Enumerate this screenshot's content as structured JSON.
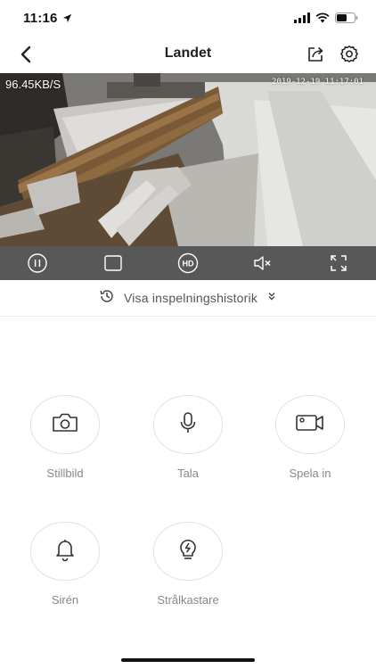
{
  "status_bar": {
    "time": "11:16"
  },
  "nav": {
    "title": "Landet"
  },
  "video": {
    "speed": "96.45KB/S",
    "timestamp": "2019-12-19 11:17:01"
  },
  "history": {
    "label": "Visa inspelningshistorik"
  },
  "actions": {
    "snapshot": "Stillbild",
    "talk": "Tala",
    "record": "Spela in",
    "siren": "Sirén",
    "spotlight": "Strålkastare"
  },
  "controls": {
    "quality_badge": "HD"
  }
}
